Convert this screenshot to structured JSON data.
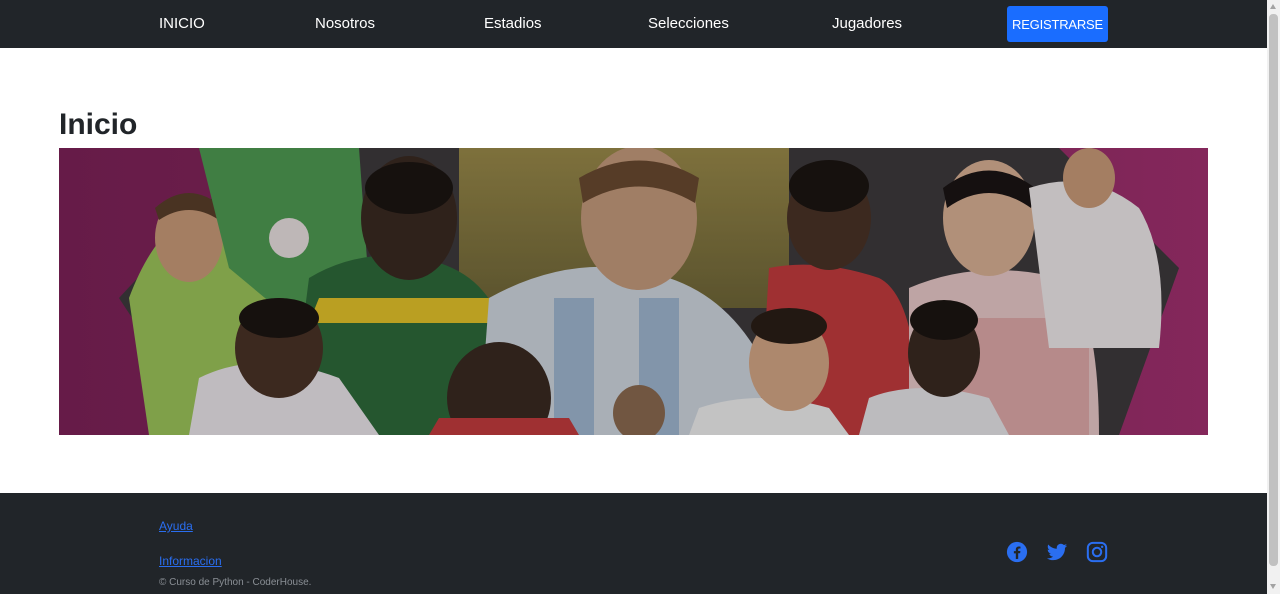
{
  "nav": {
    "items": [
      {
        "label": "INICIO"
      },
      {
        "label": "Nosotros"
      },
      {
        "label": "Estadios"
      },
      {
        "label": "Selecciones"
      },
      {
        "label": "Jugadores"
      }
    ],
    "register_label": "REGISTRARSE"
  },
  "main": {
    "title": "Inicio",
    "banner_icon": "football-players-collage"
  },
  "footer": {
    "links": [
      {
        "label": "Ayuda"
      },
      {
        "label": "Informacion"
      }
    ],
    "copyright": "© Curso de Python - CoderHouse.",
    "social_icons": [
      "facebook-icon",
      "twitter-icon",
      "instagram-icon"
    ]
  },
  "colors": {
    "navbar_bg": "#212529",
    "accent": "#1a6dff",
    "banner_magenta": "#8f2a66"
  }
}
